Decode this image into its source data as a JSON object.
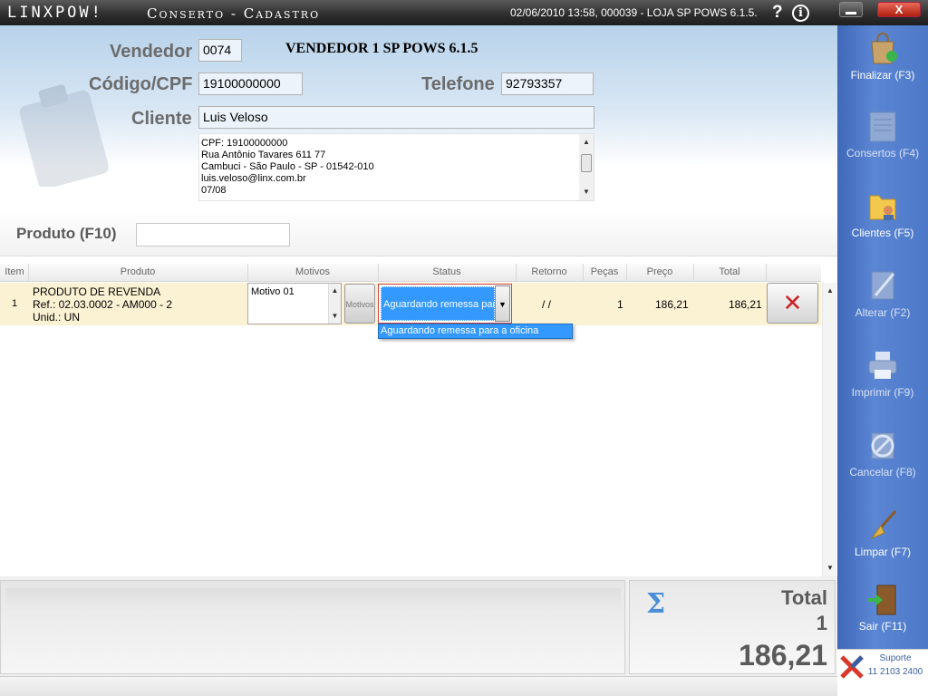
{
  "titlebar": {
    "logo": "LINXPOW!",
    "window_title": "Conserto - Cadastro",
    "info": "02/06/2010 13:58, 000039 - LOJA SP POWS 6.1.5.",
    "help": "?",
    "about": "i",
    "close": "X"
  },
  "header": {
    "vendedor_label": "Vendedor",
    "vendedor_code": "0074",
    "vendedor_name": "VENDEDOR 1 SP POWS 6.1.5",
    "cpf_label": "Código/CPF",
    "cpf_value": "19100000000",
    "telefone_label": "Telefone",
    "telefone_value": "92793357",
    "cliente_label": "Cliente",
    "cliente_value": "Luis Veloso",
    "address": [
      "CPF: 19100000000",
      "Rua Antônio Tavares 611 77",
      "Cambuci - São Paulo - SP - 01542-010",
      "luis.veloso@linx.com.br",
      "07/08"
    ]
  },
  "produto": {
    "label": "Produto (F10)",
    "value": ""
  },
  "grid": {
    "columns": [
      "Item",
      "Produto",
      "Motivos",
      "Status",
      "Retorno",
      "Peças",
      "Preço",
      "Total"
    ],
    "rows": [
      {
        "item": "1",
        "produto_line1": "PRODUTO DE REVENDA",
        "produto_line2": "Ref.: 02.03.0002 - AM000 - 2",
        "produto_line3": "Unid.: UN",
        "motivo": "Motivo 01",
        "motivos_button": "Motivos",
        "status": "Aguardando remessa para a oficina",
        "retorno": "/ /",
        "pecas": "1",
        "preco": "186,21",
        "total": "186,21"
      }
    ],
    "status_option": "Aguardando remessa para a oficina"
  },
  "totals": {
    "sigma": "Σ",
    "label": "Total",
    "qty": "1",
    "value": "186,21"
  },
  "sidebar": [
    {
      "label": "Finalizar (F3)",
      "icon": "shopping-bag-icon",
      "enabled": true
    },
    {
      "label": "Consertos (F4)",
      "icon": "repairs-form-icon",
      "enabled": false
    },
    {
      "label": "Clientes (F5)",
      "icon": "clients-folder-icon",
      "enabled": true
    },
    {
      "label": "Alterar (F2)",
      "icon": "edit-pencil-icon",
      "enabled": false
    },
    {
      "label": "Imprimir (F9)",
      "icon": "printer-icon",
      "enabled": false
    },
    {
      "label": "Cancelar (F8)",
      "icon": "cancel-icon",
      "enabled": false
    },
    {
      "label": "Limpar (F7)",
      "icon": "broom-icon",
      "enabled": true
    },
    {
      "label": "Sair (F11)",
      "icon": "exit-door-icon",
      "enabled": true
    }
  ],
  "support": {
    "label": "Suporte",
    "phone": "11 2103 2400"
  },
  "colors": {
    "sidebar": "#4d78c8",
    "selection": "#3399ff",
    "row_highlight": "#fbf1d3",
    "delete_red": "#cc2222"
  }
}
